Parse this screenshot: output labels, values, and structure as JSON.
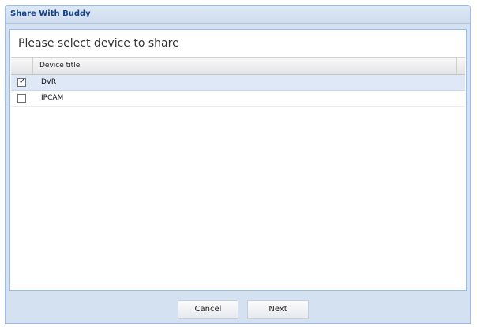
{
  "window": {
    "title": "Share With Buddy"
  },
  "main": {
    "prompt": "Please select device to share"
  },
  "grid": {
    "header": {
      "title": "Device title"
    },
    "rows": [
      {
        "title": "DVR",
        "checked": true,
        "selected": true
      },
      {
        "title": "IPCAM",
        "checked": false,
        "selected": false
      }
    ]
  },
  "footer": {
    "cancel_label": "Cancel",
    "next_label": "Next"
  },
  "icons": {
    "checkmark": "checkmark-icon"
  },
  "colors": {
    "title_text": "#15428b",
    "frame": "#d3e1f1",
    "border": "#99bbe8",
    "selected_row": "#dfe8f6"
  }
}
